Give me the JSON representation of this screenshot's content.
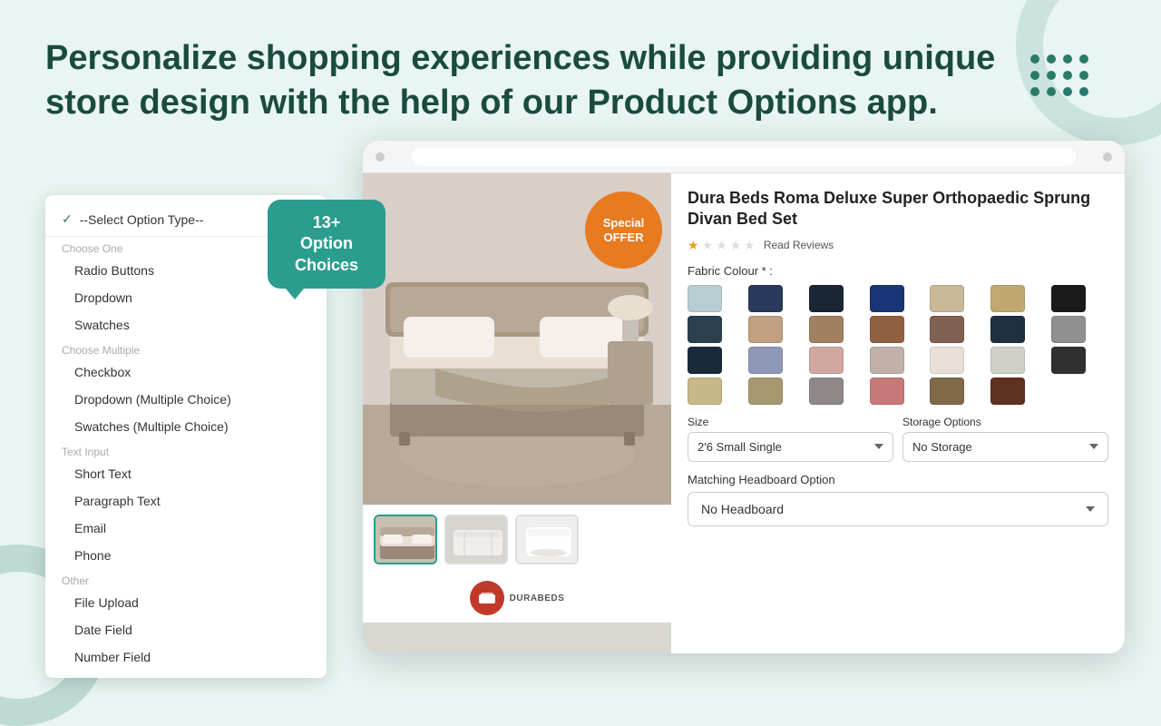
{
  "headline": {
    "line1": "Personalize shopping experiences while providing unique",
    "line2": "store design with the help of our Product Options app."
  },
  "background": {
    "accent_color": "#2a7a6a"
  },
  "tooltip": {
    "label": "13+ Option Choices"
  },
  "dropdown_menu": {
    "selected": "--Select Option Type--",
    "categories": [
      {
        "name": "Choose One",
        "items": [
          "Radio Buttons",
          "Dropdown",
          "Swatches"
        ]
      },
      {
        "name": "Choose Multiple",
        "items": [
          "Checkbox",
          "Dropdown (Multiple Choice)",
          "Swatches (Multiple Choice)"
        ]
      },
      {
        "name": "Text Input",
        "items": [
          "Short Text",
          "Paragraph Text",
          "Email",
          "Phone"
        ]
      },
      {
        "name": "Other",
        "items": [
          "File Upload",
          "Date Field",
          "Number Field"
        ]
      }
    ]
  },
  "product": {
    "title": "Dura Beds Roma Deluxe Super Orthopaedic Sprung Divan Bed Set",
    "badge": "Special OFFER",
    "fabric_label": "Fabric Colour * :",
    "swatches": [
      "#b8cdd0",
      "#2a3a5c",
      "#1a2535",
      "#1a3575",
      "#c8b898",
      "#c0a870",
      "#1a1a1a",
      "#2a4050",
      "#c0a080",
      "#a08060",
      "#906040",
      "#806050",
      "#203040",
      "#909090",
      "#1a2a3a",
      "#9098b8",
      "#d0a8a0",
      "#c0b0a8",
      "#e8e0d8",
      "#d0d0c8",
      "#303030"
    ],
    "size_label": "Size",
    "size_value": "2'6 Small Single",
    "storage_label": "Storage Options",
    "storage_value": "No Storage",
    "headboard_label": "Matching Headboard Option",
    "headboard_value": "No Headboard",
    "read_reviews": "Read Reviews",
    "brand": "DURABEDS",
    "stars": [
      1,
      0,
      0,
      0,
      0
    ]
  },
  "thumbnails": [
    "bed1",
    "mattress",
    "white-mattress"
  ]
}
